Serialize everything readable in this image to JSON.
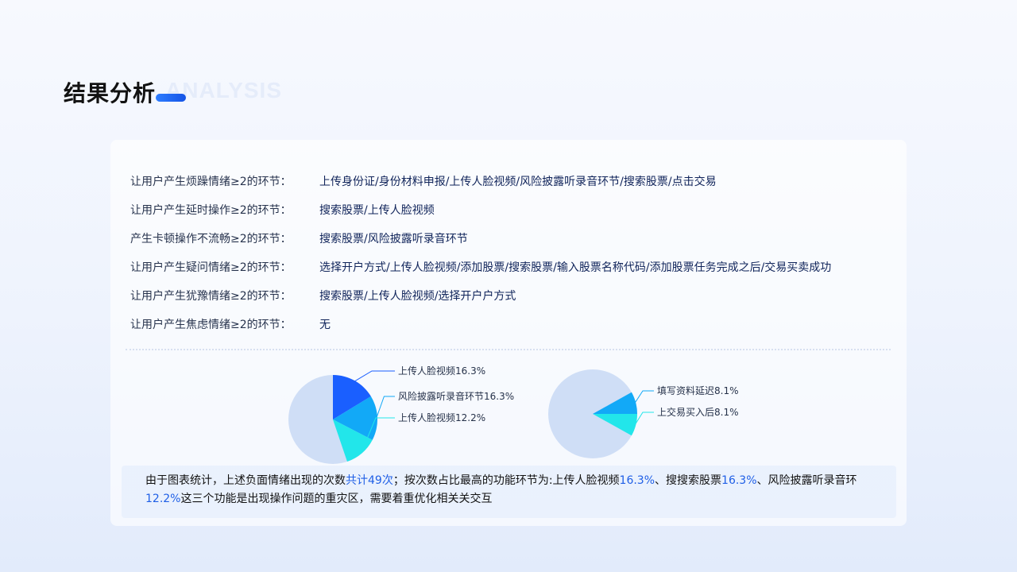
{
  "page": {
    "title": "结果分析",
    "watermark": "ANALYSIS"
  },
  "rows": [
    {
      "label": "让用户产生烦躁情绪≥2的环节：",
      "value": "上传身份证/身份材料申报/上传人脸视频/风险披露听录音环节/搜索股票/点击交易"
    },
    {
      "label": "让用户产生延时操作≥2的环节：",
      "value": "搜索股票/上传人脸视频"
    },
    {
      "label": "产生卡顿操作不流畅≥2的环节：",
      "value": "搜索股票/风险披露听录音环节"
    },
    {
      "label": "让用户产生疑问情绪≥2的环节：",
      "value": "选择开户方式/上传人脸视频/添加股票/搜索股票/输入股票名称代码/添加股票任务完成之后/交易买卖成功"
    },
    {
      "label": "让用户产生犹豫情绪≥2的环节：",
      "value": "搜索股票/上传人脸视频/选择开户户方式"
    },
    {
      "label": "让用户产生焦虑情绪≥2的环节：",
      "value": "无"
    }
  ],
  "chart_data": [
    {
      "type": "pie",
      "series": [
        {
          "label": "上传人脸视频16.3%",
          "value": 16.3,
          "color": "#1a5fff"
        },
        {
          "label": "风险披露听录音环节16.3%",
          "value": 16.3,
          "color": "#12a9f7"
        },
        {
          "label": "上传人脸视频12.2%",
          "value": 12.2,
          "color": "#22e6ea"
        }
      ],
      "rest_color": "#cfdef6"
    },
    {
      "type": "pie",
      "series": [
        {
          "label": "填写资料延迟8.1%",
          "value": 8.1,
          "color": "#12a9f7"
        },
        {
          "label": "上交易买入后8.1%",
          "value": 8.1,
          "color": "#22e6ea"
        }
      ],
      "rest_color": "#cfdef6"
    }
  ],
  "conclusion": {
    "p1": "由于图表统计，上述负面情绪出现的次数",
    "h1": "共计49次",
    "p2": "；按次数占比最高的功能环节为:上传人脸视频",
    "h2": "16.3%",
    "p3": "、搜搜索股票",
    "h3": "16.3%",
    "p4": "、风险披露听录音环",
    "h4": "12.2%",
    "p5": "这三个功能是出现操作问题的重灾区，需要着重优化相关关交互"
  }
}
